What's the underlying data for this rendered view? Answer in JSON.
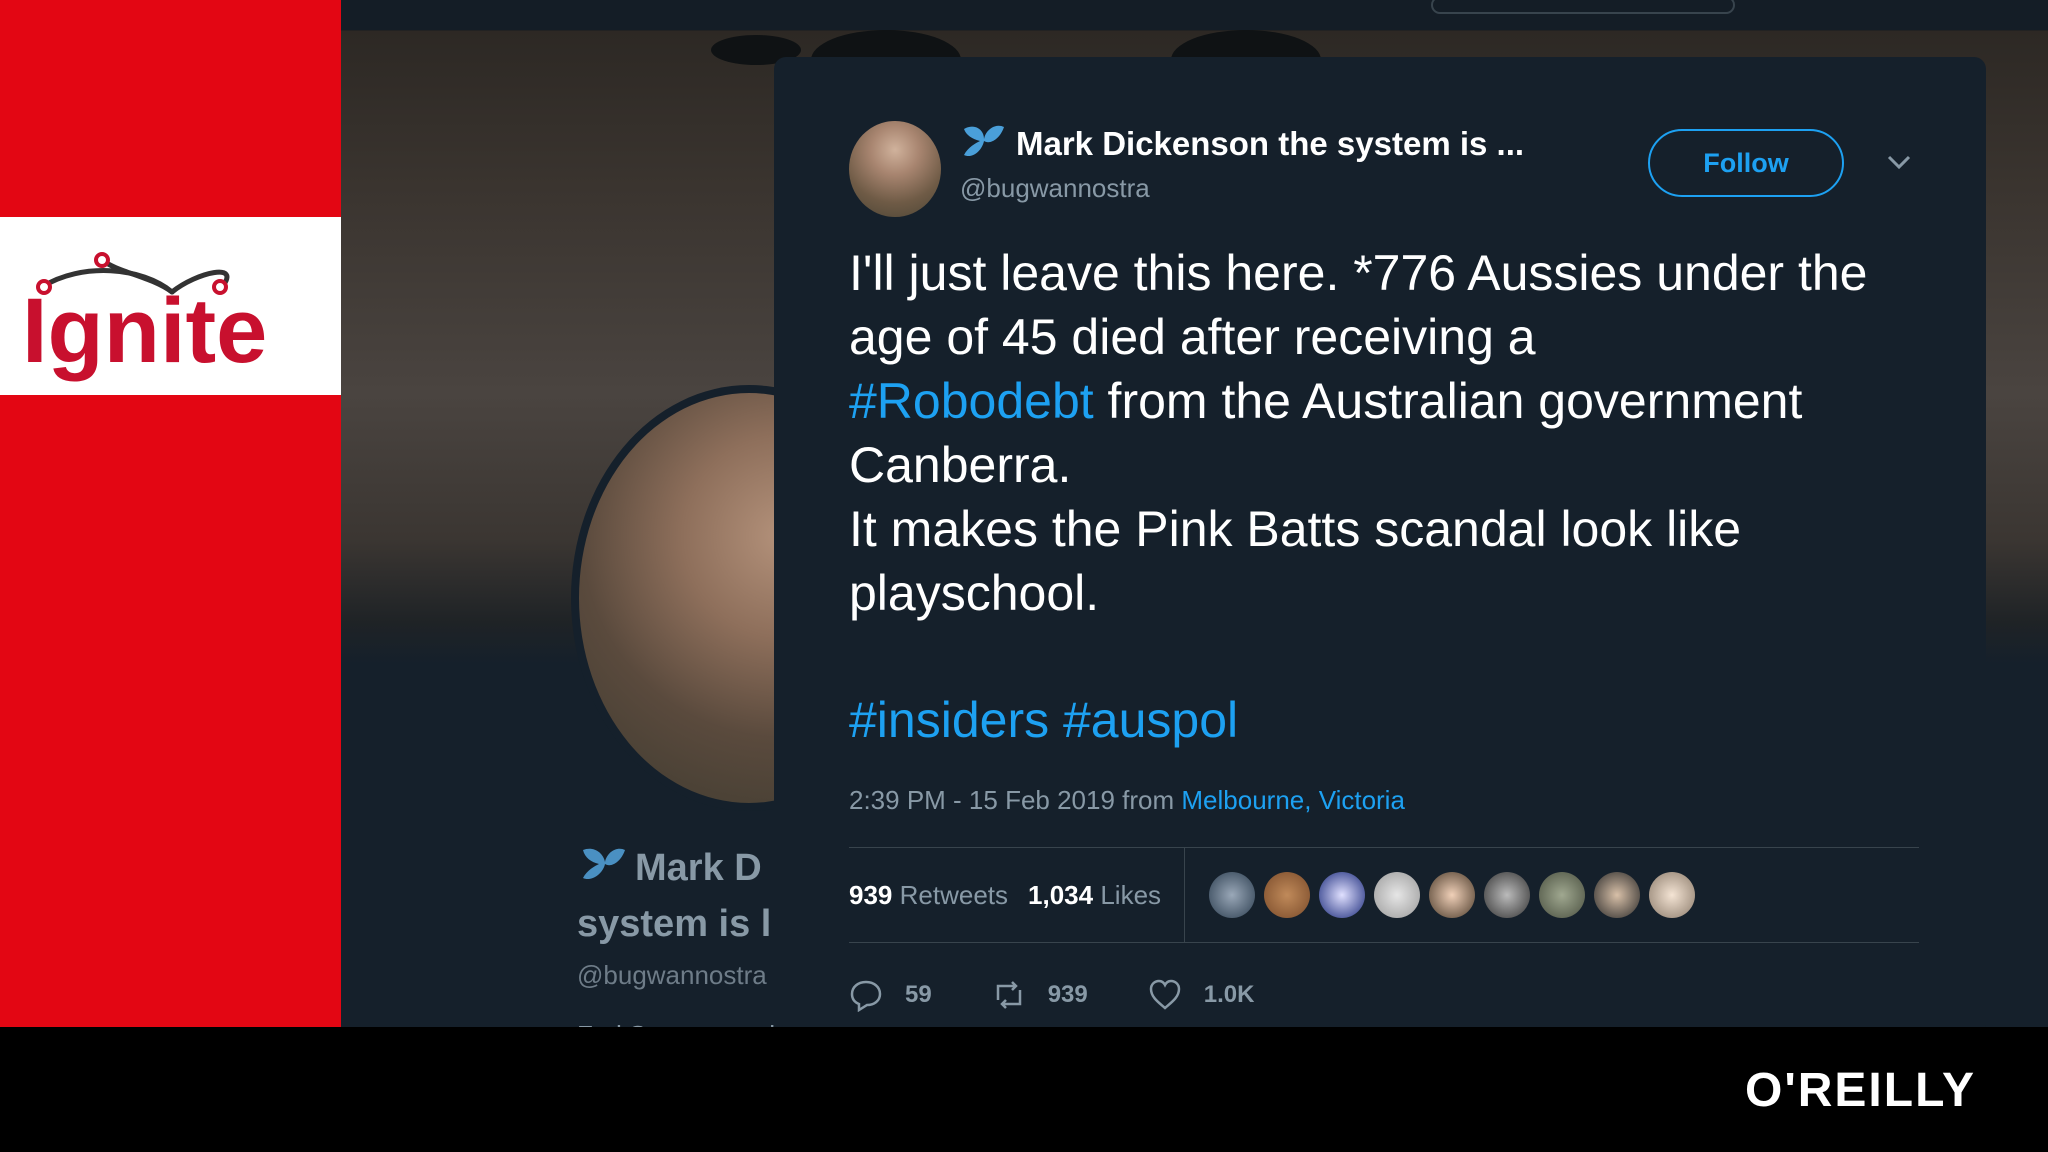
{
  "ignite": {
    "logo_text": "Ignite"
  },
  "background_profile": {
    "name": "Mark D",
    "name_line2": "system is l",
    "handle": "@bugwannostra",
    "bio": "Fed Senate cand"
  },
  "tweet": {
    "display_name": "Mark Dickenson the system is ...",
    "handle": "@bugwannostra",
    "follow_label": "Follow",
    "text": {
      "line1": "I'll just leave this here.   *776 Aussies under the age of 45 died after receiving a",
      "hashtag_robodebt": "#Robodebt",
      "line2": " from the Australian government Canberra.",
      "line3": "It makes the Pink Batts scandal look like playschool."
    },
    "hashtags": "#insiders #auspol",
    "meta": {
      "time": "2:39 PM - 15 Feb 2019 from ",
      "location": "Melbourne, Victoria"
    },
    "stats": {
      "retweets_count": "939",
      "retweets_label": "Retweets",
      "likes_count": "1,034",
      "likes_label": "Likes"
    },
    "actions": {
      "replies": "59",
      "retweets": "939",
      "likes": "1.0K"
    }
  },
  "footer": {
    "brand": "O'REILLY"
  },
  "colors": {
    "ignite_red": "#e30613",
    "twitter_blue": "#1da1f2",
    "card_bg": "#15202b"
  }
}
